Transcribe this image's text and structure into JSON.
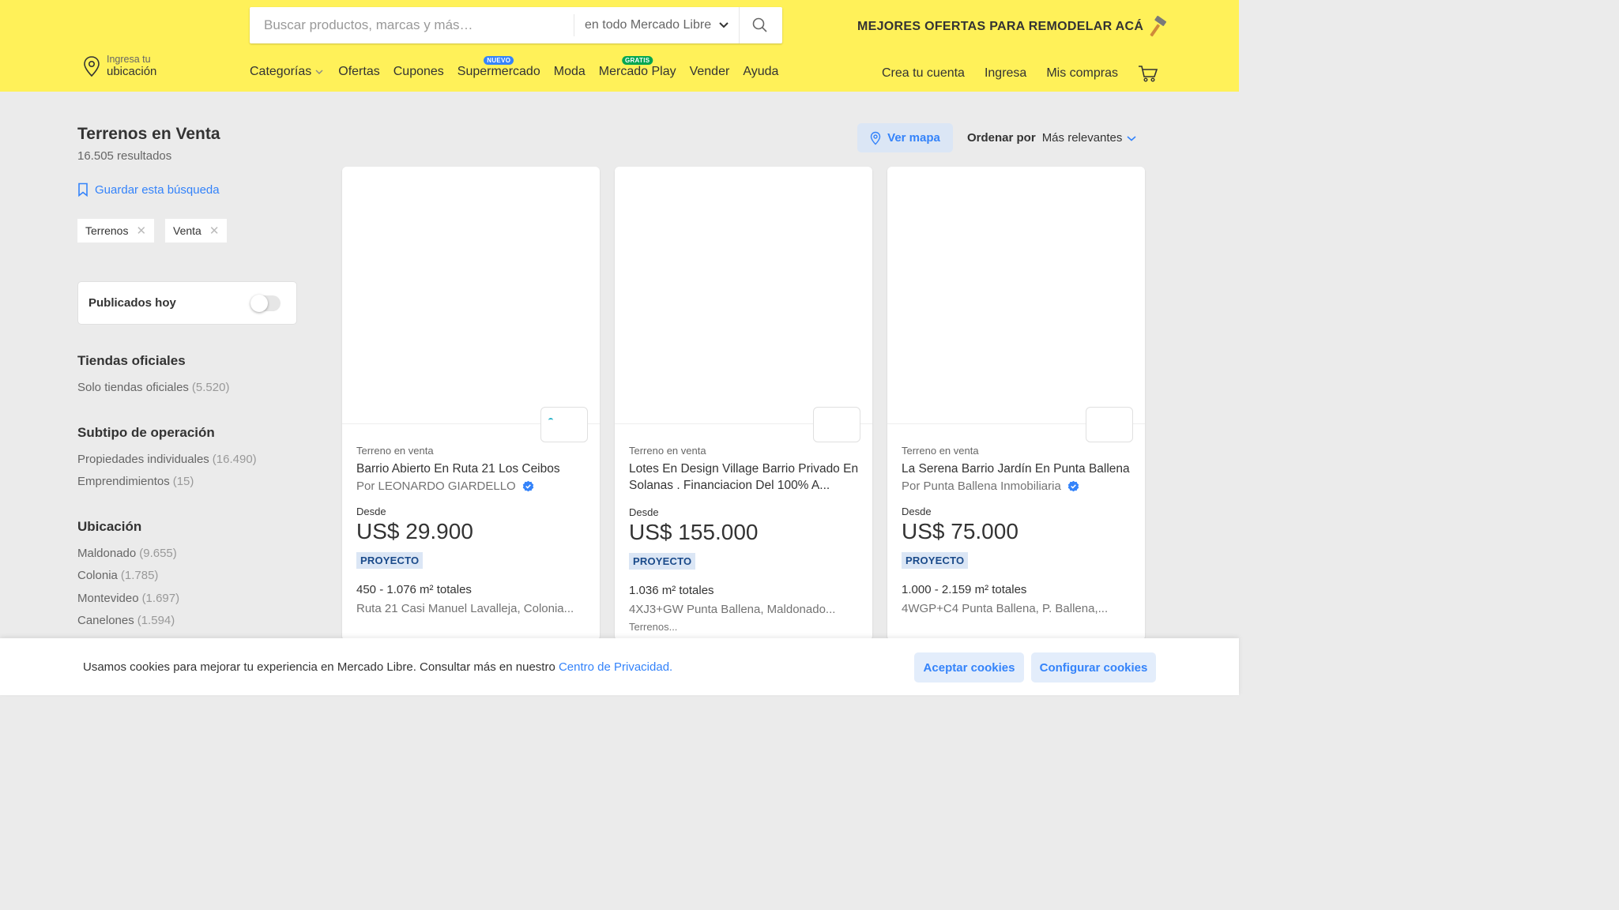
{
  "header": {
    "search": {
      "placeholder": "Buscar productos, marcas y más…",
      "scope": "en todo Mercado Libre"
    },
    "promo": "MEJORES OFERTAS PARA REMODELAR ACÁ",
    "location": {
      "line1": "Ingresa tu",
      "line2": "ubicación"
    },
    "nav": [
      {
        "label": "Categorías"
      },
      {
        "label": "Ofertas"
      },
      {
        "label": "Cupones"
      },
      {
        "label": "Supermercado",
        "badge": "NUEVO"
      },
      {
        "label": "Moda"
      },
      {
        "label": "Mercado Play",
        "badge": "GRATIS"
      },
      {
        "label": "Vender"
      },
      {
        "label": "Ayuda"
      }
    ],
    "account": [
      "Crea tu cuenta",
      "Ingresa",
      "Mis compras"
    ],
    "colors": {
      "yellow": "#fff159",
      "blue": "#3483fa",
      "green": "#00a650"
    }
  },
  "results": {
    "title": "Terrenos en Venta",
    "count": "16.505 resultados",
    "save_search": "Guardar esta búsqueda",
    "chips": [
      "Terrenos",
      "Venta"
    ]
  },
  "filters": {
    "toggle_label": "Publicados hoy",
    "groups": [
      {
        "title": "Tiendas oficiales",
        "items": [
          {
            "label": "Solo tiendas oficiales",
            "count": "(5.520)"
          }
        ]
      },
      {
        "title": "Subtipo de operación",
        "items": [
          {
            "label": "Propiedades individuales",
            "count": "(16.490)"
          },
          {
            "label": "Emprendimientos",
            "count": "(15)"
          }
        ]
      },
      {
        "title": "Ubicación",
        "items": [
          {
            "label": "Maldonado",
            "count": "(9.655)"
          },
          {
            "label": "Colonia",
            "count": "(1.785)"
          },
          {
            "label": "Montevideo",
            "count": "(1.697)"
          },
          {
            "label": "Canelones",
            "count": "(1.594)"
          }
        ]
      }
    ]
  },
  "controls": {
    "map_button": "Ver mapa",
    "sort_label": "Ordenar por",
    "sort_value": "Más relevantes"
  },
  "cards": [
    {
      "type": "Terreno en venta",
      "title": "Barrio Abierto En Ruta 21 Los Ceibos",
      "seller": "Por LEONARDO GIARDELLO",
      "desde": "Desde",
      "price": "US$ 29.900",
      "badge": "PROYECTO",
      "area": "450 - 1.076 m² totales",
      "address": "Ruta 21 Casi Manuel Lavalleja, Colonia..."
    },
    {
      "type": "Terreno en venta",
      "title": "Lotes En Design Village Barrio Privado En Solanas . Financiacion Del 100% A...",
      "desde": "Desde",
      "price": "US$ 155.000",
      "badge": "PROYECTO",
      "area": "1.036 m² totales",
      "address": "4XJ3+GW Punta Ballena, Maldonado...",
      "extra": "Terrenos..."
    },
    {
      "type": "Terreno en venta",
      "title": "La Serena Barrio Jardín En Punta Ballena",
      "seller": "Por Punta Ballena Inmobiliaria",
      "desde": "Desde",
      "price": "US$ 75.000",
      "badge": "PROYECTO",
      "area": "1.000 - 2.159 m² totales",
      "address": "4WGP+C4 Punta Ballena, P. Ballena,..."
    }
  ],
  "cookie": {
    "text": "Usamos cookies para mejorar tu experiencia en Mercado Libre. Consultar más en nuestro",
    "link": "Centro de Privacidad.",
    "accept": "Aceptar cookies",
    "configure": "Configurar cookies"
  }
}
